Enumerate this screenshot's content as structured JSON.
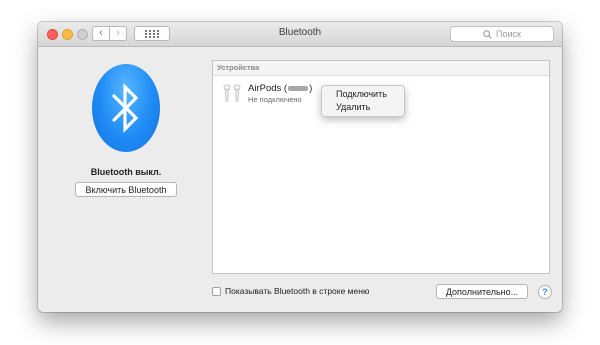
{
  "window": {
    "title": "Bluetooth",
    "search_placeholder": "Поиск"
  },
  "toolbar": {
    "back_glyph": "‹",
    "forward_glyph": "›"
  },
  "bluetooth": {
    "status": "Bluetooth выкл.",
    "enable_button": "Включить Bluetooth"
  },
  "devices": {
    "header": "Устройства",
    "items": [
      {
        "name": "AirPods (",
        "name_suffix": ")",
        "status": "Не подключено",
        "icon": "airpods-icon"
      }
    ]
  },
  "context_menu": {
    "items": [
      "Подключить",
      "Удалить"
    ]
  },
  "footer": {
    "show_in_menu_label": "Показывать Bluetooth в строке меню",
    "show_in_menu_checked": false,
    "advanced_button": "Дополнительно...",
    "help_glyph": "?"
  },
  "colors": {
    "accent": "#1f8bf5",
    "close": "#fc605c",
    "minimize": "#fdbc40"
  }
}
